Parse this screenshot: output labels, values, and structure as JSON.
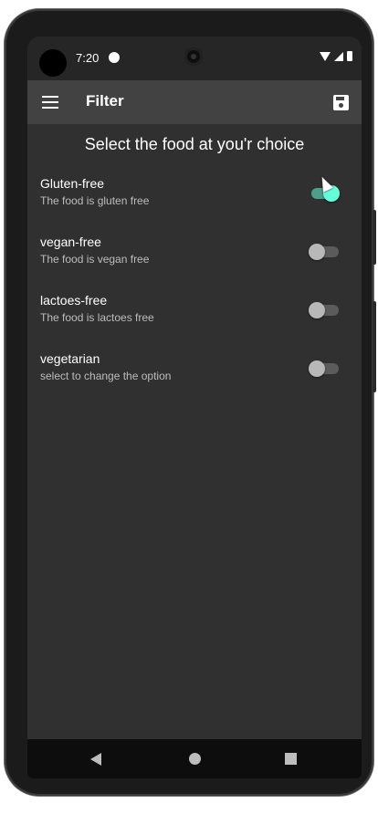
{
  "status_bar": {
    "time": "7:20"
  },
  "app_bar": {
    "title": "Filter",
    "menu_icon": "menu-icon",
    "save_icon": "save-icon"
  },
  "heading": "Select the food at you'r choice",
  "options": [
    {
      "title": "Gluten-free",
      "subtitle": "The food is gluten free",
      "enabled": true
    },
    {
      "title": "vegan-free",
      "subtitle": "The food is vegan free",
      "enabled": false
    },
    {
      "title": "lactoes-free",
      "subtitle": "The food is lactoes free",
      "enabled": false
    },
    {
      "title": "vegetarian",
      "subtitle": "select to change the option",
      "enabled": false
    }
  ],
  "colors": {
    "background": "#303030",
    "app_bar": "#424242",
    "switch_on_thumb": "#64ffda",
    "switch_on_track": "#4b9e8a"
  }
}
